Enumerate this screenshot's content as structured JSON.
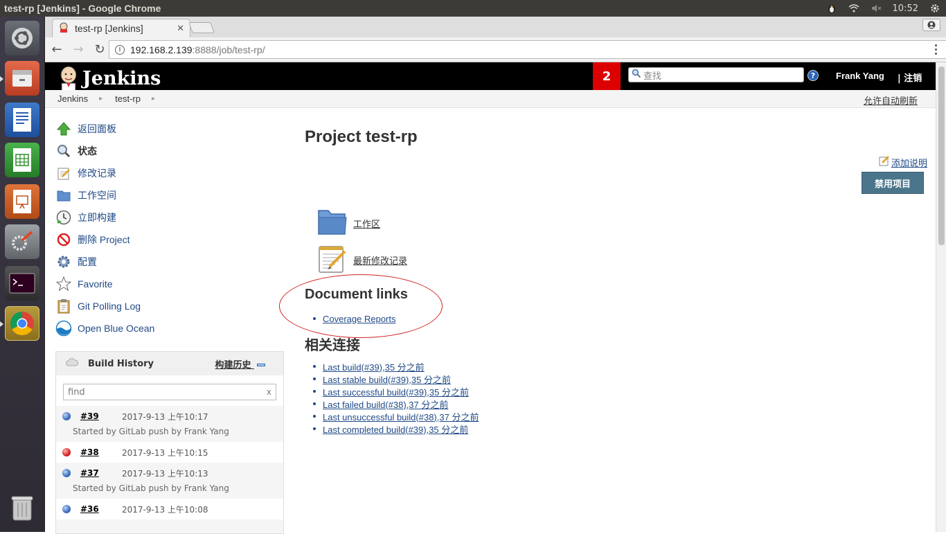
{
  "os": {
    "window_title": "test-rp [Jenkins] - Google Chrome",
    "clock": "10:52"
  },
  "browser": {
    "tab_title": "test-rp [Jenkins]",
    "tab_close": "✕",
    "url_host": "192.168.2.139",
    "url_rest": ":8888/job/test-rp/"
  },
  "header": {
    "logo_text": "Jenkins",
    "notification_count": "2",
    "search_placeholder": "查找",
    "user_name": "Frank Yang",
    "logout": "| 注销"
  },
  "breadcrumb": {
    "items": [
      "Jenkins",
      "test-rp"
    ],
    "auto_refresh": "允许自动刷新"
  },
  "tasks": [
    {
      "label": "返回面板",
      "icon": "up-arrow-icon"
    },
    {
      "label": "状态",
      "icon": "search-icon"
    },
    {
      "label": "修改记录",
      "icon": "notepad-icon"
    },
    {
      "label": "工作空间",
      "icon": "folder-icon"
    },
    {
      "label": "立即构建",
      "icon": "clock-icon"
    },
    {
      "label": "删除 Project",
      "icon": "no-entry-icon"
    },
    {
      "label": "配置",
      "icon": "gear-icon"
    },
    {
      "label": "Favorite",
      "icon": "star-icon"
    },
    {
      "label": "Git Polling Log",
      "icon": "clipboard-icon"
    },
    {
      "label": "Open Blue Ocean",
      "icon": "blue-ocean-icon"
    }
  ],
  "build_history": {
    "title": "Build History",
    "trend": "构建历史",
    "filter_placeholder": "find",
    "filter_clear": "x",
    "builds": [
      {
        "number": "#39",
        "date": "2017-9-13 上午10:17",
        "status": "blue",
        "cause": "Started by GitLab push by Frank Yang"
      },
      {
        "number": "#38",
        "date": "2017-9-13 上午10:15",
        "status": "red",
        "cause": ""
      },
      {
        "number": "#37",
        "date": "2017-9-13 上午10:13",
        "status": "blue",
        "cause": "Started by GitLab push by Frank Yang"
      },
      {
        "number": "#36",
        "date": "2017-9-13 上午10:08",
        "status": "blue",
        "cause": ""
      }
    ]
  },
  "main": {
    "title": "Project test-rp",
    "add_description": "添加说明",
    "disable_button": "禁用项目",
    "workspace_link": "工作区",
    "changes_link": "最新修改记录",
    "doc_links_title": "Document links",
    "doc_links": [
      "Coverage Reports"
    ],
    "related_title": "相关连接",
    "related_links": [
      "Last build(#39),35 分之前",
      "Last stable build(#39),35 分之前",
      "Last successful build(#39),35 分之前",
      "Last failed build(#38),37 分之前",
      "Last unsuccessful build(#38),37 分之前",
      "Last completed build(#39),35 分之前"
    ]
  },
  "colors": {
    "header_bg": "#000000",
    "badge_red": "#dd0000",
    "link_blue": "#204a87",
    "button_bg": "#4b758b",
    "annotation_red": "#d02020"
  }
}
